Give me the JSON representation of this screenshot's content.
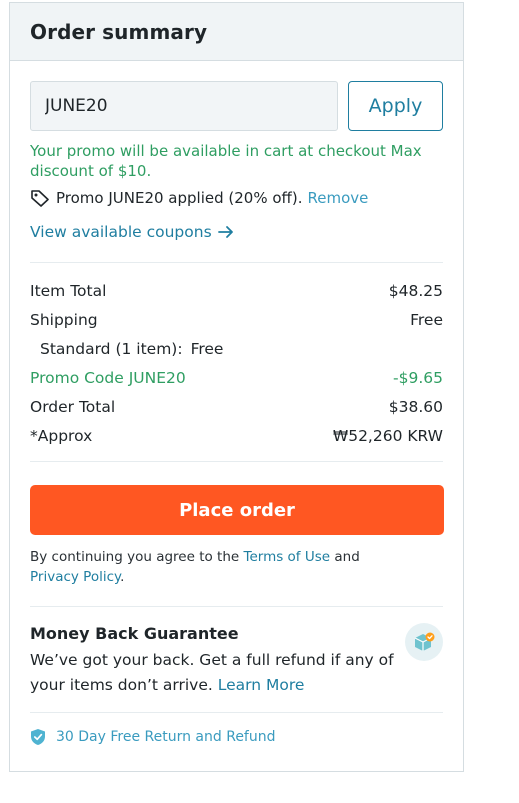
{
  "header": {
    "title": "Order summary"
  },
  "promo": {
    "input_value": "JUNE20",
    "apply_label": "Apply",
    "message": "Your promo will be available in cart at checkout Max discount of $10.",
    "applied_text": "Promo JUNE20 applied (20% off).",
    "remove_label": "Remove",
    "coupons_label": "View available coupons"
  },
  "totals": {
    "item_total_label": "Item Total",
    "item_total_value": "$48.25",
    "shipping_label": "Shipping",
    "shipping_value": "Free",
    "standard_label": "Standard (1 item):",
    "standard_value": "Free",
    "promo_label": "Promo Code JUNE20",
    "promo_value": "-$9.65",
    "order_total_label": "Order Total",
    "order_total_value": "$38.60",
    "approx_label": "*Approx",
    "approx_value": "₩52,260 KRW"
  },
  "checkout": {
    "place_order_label": "Place order",
    "terms_prefix": "By continuing you agree to the ",
    "terms_link": "Terms of Use",
    "terms_and": " and",
    "privacy_link": "Privacy Policy",
    "terms_suffix": "."
  },
  "guarantee": {
    "title": "Money Back Guarantee",
    "text": "We’ve got your back. Get a full refund if any of your items don’t arrive. ",
    "learn_more": "Learn More",
    "badge_icon": "box-check-icon"
  },
  "return_policy": {
    "label": "30 Day Free Return and Refund",
    "icon": "shield-check-icon"
  },
  "colors": {
    "accent": "#1f7ea0",
    "promo_green": "#2f9e62",
    "place_order": "#ff5722",
    "header_bg": "#f0f4f6"
  }
}
